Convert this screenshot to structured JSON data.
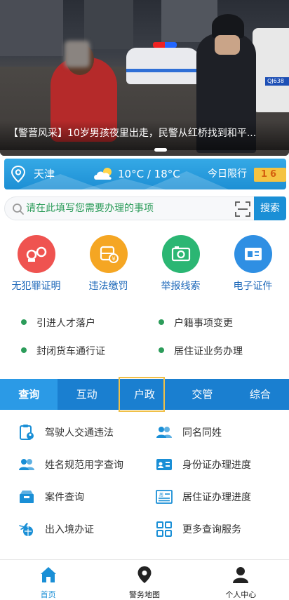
{
  "banner": {
    "caption": "【警营风采】10岁男孩夜里出走，民警从红桥找到和平...",
    "plate_text": "QJ638"
  },
  "weather": {
    "city": "天津",
    "temperature": "10°C / 18°C",
    "limit_label": "今日限行",
    "limit_value": "16"
  },
  "search": {
    "placeholder": "请在此填写您需要办理的事项",
    "button_label": "搜索"
  },
  "quick": [
    {
      "label": "无犯罪证明",
      "color": "#ef5350"
    },
    {
      "label": "违法缴罚",
      "color": "#f5a623"
    },
    {
      "label": "举报线索",
      "color": "#2bb673"
    },
    {
      "label": "电子证件",
      "color": "#2f8fe3"
    }
  ],
  "links": [
    {
      "label": "引进人才落户"
    },
    {
      "label": "户籍事项变更"
    },
    {
      "label": "封闭货车通行证"
    },
    {
      "label": "居住证业务办理"
    }
  ],
  "tabs": [
    {
      "label": "查询"
    },
    {
      "label": "互动"
    },
    {
      "label": "户政"
    },
    {
      "label": "交管"
    },
    {
      "label": "综合"
    }
  ],
  "services": [
    {
      "label": "驾驶人交通违法"
    },
    {
      "label": "同名同姓"
    },
    {
      "label": "姓名规范用字查询"
    },
    {
      "label": "身份证办理进度"
    },
    {
      "label": "案件查询"
    },
    {
      "label": "居住证办理进度"
    },
    {
      "label": "出入境办证"
    },
    {
      "label": "更多查询服务"
    }
  ],
  "nav": [
    {
      "label": "首页"
    },
    {
      "label": "警务地图"
    },
    {
      "label": "个人中心"
    }
  ],
  "colors": {
    "primary": "#1a8fd6",
    "tab_bar": "#1a7fd0",
    "accent_green": "#2c9c5a",
    "limit_bg": "#f5c342"
  }
}
